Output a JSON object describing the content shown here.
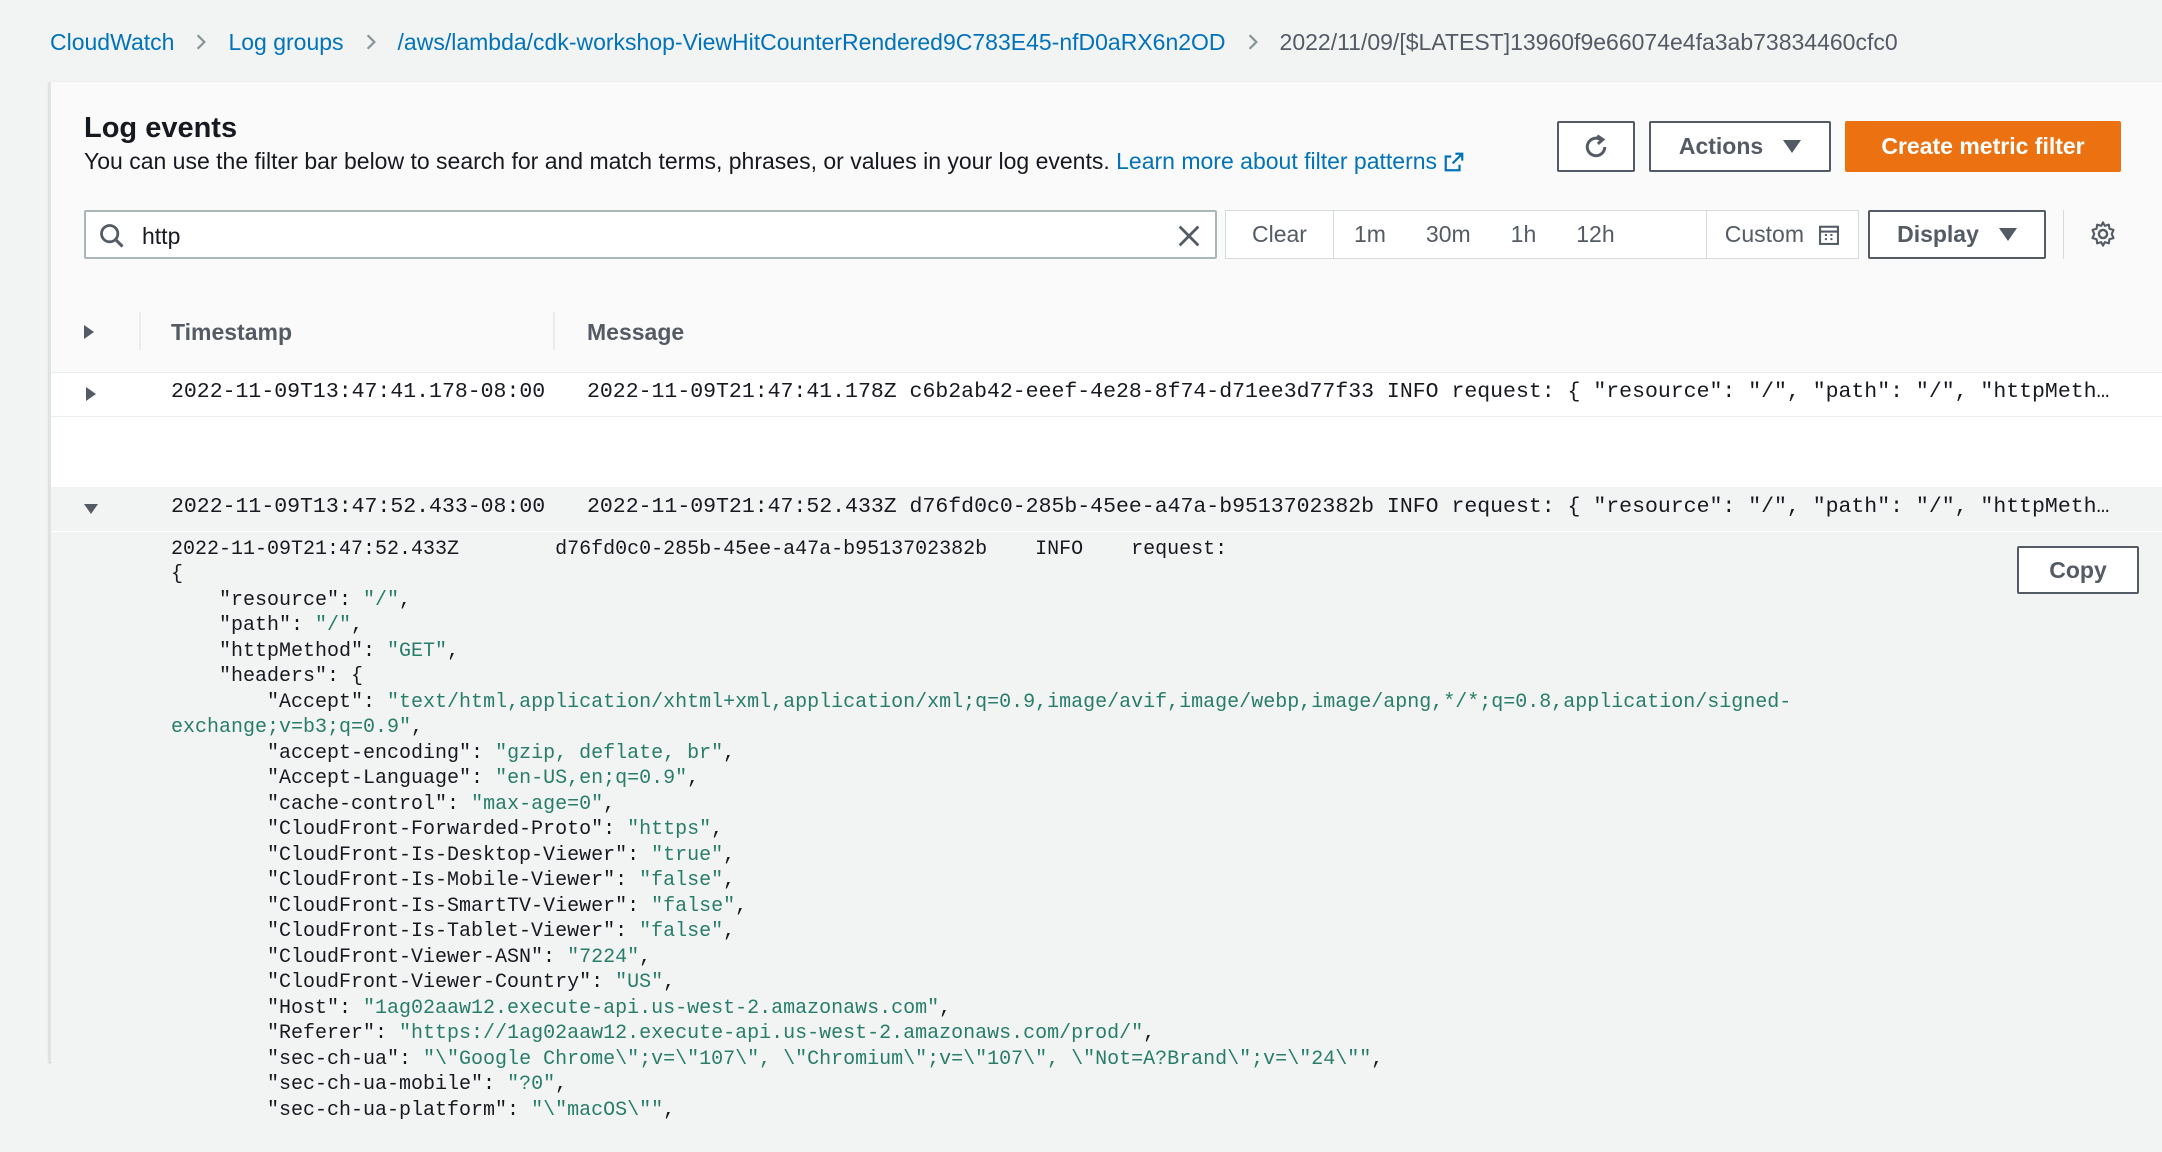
{
  "breadcrumb": {
    "items": [
      "CloudWatch",
      "Log groups",
      "/aws/lambda/cdk-workshop-ViewHitCounterRendered9C783E45-nfD0aRX6n2OD"
    ],
    "current": "2022/11/09/[$LATEST]13960f9e66074e4fa3ab73834460cfc0"
  },
  "header": {
    "title": "Log events",
    "description": "You can use the filter bar below to search for and match terms, phrases, or values in your log events. ",
    "learn_more": "Learn more about filter patterns"
  },
  "toolbar": {
    "actions_label": "Actions",
    "create_label": "Create metric filter",
    "display_label": "Display"
  },
  "search": {
    "value": "http"
  },
  "range": {
    "clear": "Clear",
    "options": [
      "1m",
      "30m",
      "1h",
      "12h"
    ],
    "custom": "Custom"
  },
  "table": {
    "columns": [
      "Timestamp",
      "Message"
    ],
    "rows": [
      {
        "timestamp": "2022-11-09T13:47:41.178-08:00",
        "message": "2022-11-09T21:47:41.178Z c6b2ab42-eeef-4e28-8f74-d71ee3d77f33 INFO request: { \"resource\": \"/\", \"path\": \"/\", \"httpMethod\": \"GET\", \"headers\": { \"Accept\": \"text/html,application/xhtml+xml\" }",
        "expanded": false
      },
      {
        "timestamp": "2022-11-09T13:47:52.433-08:00",
        "message": "2022-11-09T21:47:52.433Z d76fd0c0-285b-45ee-a47a-b9513702382b INFO request: { \"resource\": \"/\", \"path\": \"/\", \"httpMethod\": \"GET\", \"headers\": { \"Accept\": \"text/html,application/xhtml+xml\" }",
        "expanded": true
      }
    ]
  },
  "detail": {
    "head": "2022-11-09T21:47:52.433Z        d76fd0c0-285b-45ee-a47a-b9513702382b    INFO    request:",
    "copy_label": "Copy",
    "lines": [
      {
        "pre": "{",
        "val": "",
        "post": ""
      },
      {
        "pre": "    \"resource\": ",
        "val": "\"/\"",
        "post": ","
      },
      {
        "pre": "    \"path\": ",
        "val": "\"/\"",
        "post": ","
      },
      {
        "pre": "    \"httpMethod\": ",
        "val": "\"GET\"",
        "post": ","
      },
      {
        "pre": "    \"headers\": {",
        "val": "",
        "post": ""
      },
      {
        "pre": "        \"Accept\": ",
        "val": "\"text/html,application/xhtml+xml,application/xml;q=0.9,image/avif,image/webp,image/apng,*/*;q=0.8,application/signed-",
        "post": ""
      },
      {
        "pre": "",
        "val": "exchange;v=b3;q=0.9\"",
        "post": ","
      },
      {
        "pre": "        \"accept-encoding\": ",
        "val": "\"gzip, deflate, br\"",
        "post": ","
      },
      {
        "pre": "        \"Accept-Language\": ",
        "val": "\"en-US,en;q=0.9\"",
        "post": ","
      },
      {
        "pre": "        \"cache-control\": ",
        "val": "\"max-age=0\"",
        "post": ","
      },
      {
        "pre": "        \"CloudFront-Forwarded-Proto\": ",
        "val": "\"https\"",
        "post": ","
      },
      {
        "pre": "        \"CloudFront-Is-Desktop-Viewer\": ",
        "val": "\"true\"",
        "post": ","
      },
      {
        "pre": "        \"CloudFront-Is-Mobile-Viewer\": ",
        "val": "\"false\"",
        "post": ","
      },
      {
        "pre": "        \"CloudFront-Is-SmartTV-Viewer\": ",
        "val": "\"false\"",
        "post": ","
      },
      {
        "pre": "        \"CloudFront-Is-Tablet-Viewer\": ",
        "val": "\"false\"",
        "post": ","
      },
      {
        "pre": "        \"CloudFront-Viewer-ASN\": ",
        "val": "\"7224\"",
        "post": ","
      },
      {
        "pre": "        \"CloudFront-Viewer-Country\": ",
        "val": "\"US\"",
        "post": ","
      },
      {
        "pre": "        \"Host\": ",
        "val": "\"1ag02aaw12.execute-api.us-west-2.amazonaws.com\"",
        "post": ","
      },
      {
        "pre": "        \"Referer\": ",
        "val": "\"https://1ag02aaw12.execute-api.us-west-2.amazonaws.com/prod/\"",
        "post": ","
      },
      {
        "pre": "        \"sec-ch-ua\": ",
        "val": "\"\\\"Google Chrome\\\";v=\\\"107\\\", \\\"Chromium\\\";v=\\\"107\\\", \\\"Not=A?Brand\\\";v=\\\"24\\\"\"",
        "post": ","
      },
      {
        "pre": "        \"sec-ch-ua-mobile\": ",
        "val": "\"?0\"",
        "post": ","
      },
      {
        "pre": "        \"sec-ch-ua-platform\": ",
        "val": "\"\\\"macOS\\\"\"",
        "post": ","
      }
    ]
  },
  "colors": {
    "link": "#0073bb",
    "primary_button": "#ec7211",
    "json_value": "#287d6a"
  },
  "icons": [
    "chevron-right-icon",
    "external-link-icon",
    "refresh-icon",
    "caret-down-icon",
    "search-icon",
    "close-icon",
    "calendar-icon",
    "gear-icon",
    "expand-icon",
    "collapse-icon"
  ]
}
